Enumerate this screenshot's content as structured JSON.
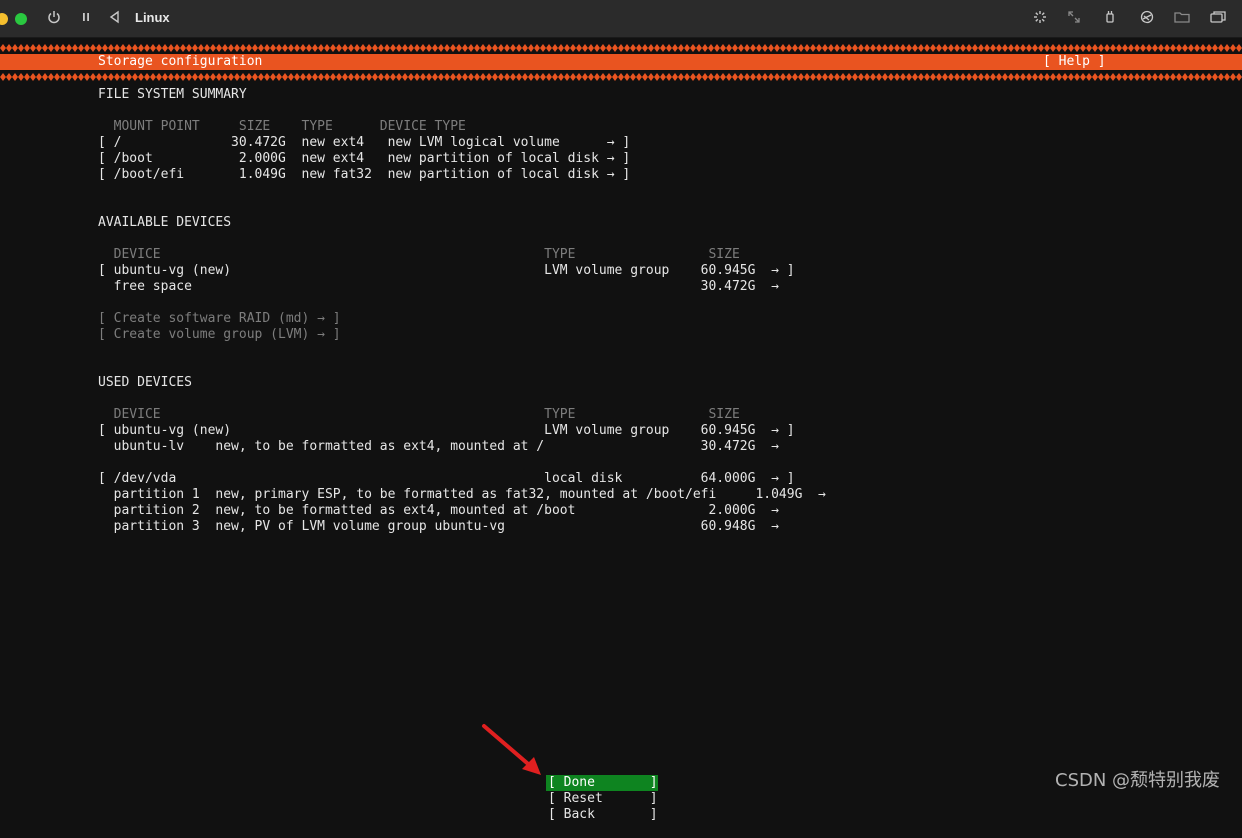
{
  "window": {
    "title": "Linux"
  },
  "colors": {
    "accent": "#e95420",
    "selected": "#0e8420",
    "annotation_arrow": "#e02020"
  },
  "toolbar_icons": [
    "power-icon",
    "pause-icon",
    "back-icon",
    "spinner-icon",
    "resize-icon",
    "usb-icon",
    "network-icon",
    "folder-icon",
    "window-icon"
  ],
  "header": {
    "title": "Storage configuration",
    "help": "[ Help ]"
  },
  "fs_summary": {
    "title": "FILE SYSTEM SUMMARY",
    "columns": "  MOUNT POINT     SIZE    TYPE      DEVICE TYPE",
    "rows": [
      "[ /              30.472G  new ext4   new LVM logical volume      → ]",
      "[ /boot           2.000G  new ext4   new partition of local disk → ]",
      "[ /boot/efi       1.049G  new fat32  new partition of local disk → ]"
    ]
  },
  "available": {
    "title": "AVAILABLE DEVICES",
    "columns": "  DEVICE                                                 TYPE                 SIZE",
    "rows": [
      "[ ubuntu-vg (new)                                        LVM volume group    60.945G  → ]",
      "  free space                                                                 30.472G  →"
    ],
    "actions": [
      "[ Create software RAID (md) → ]",
      "[ Create volume group (LVM) → ]"
    ]
  },
  "used": {
    "title": "USED DEVICES",
    "columns": "  DEVICE                                                 TYPE                 SIZE",
    "rows": [
      "[ ubuntu-vg (new)                                        LVM volume group    60.945G  → ]",
      "  ubuntu-lv    new, to be formatted as ext4, mounted at /                    30.472G  →",
      "",
      "[ /dev/vda                                               local disk          64.000G  → ]",
      "  partition 1  new, primary ESP, to be formatted as fat32, mounted at /boot/efi     1.049G  →",
      "  partition 2  new, to be formatted as ext4, mounted at /boot                 2.000G  →",
      "  partition 3  new, PV of LVM volume group ubuntu-vg                         60.948G  →"
    ]
  },
  "buttons": {
    "done": "[ Done       ]",
    "reset": "[ Reset      ]",
    "back": "[ Back       ]"
  },
  "watermark": "CSDN @颓特别我废"
}
